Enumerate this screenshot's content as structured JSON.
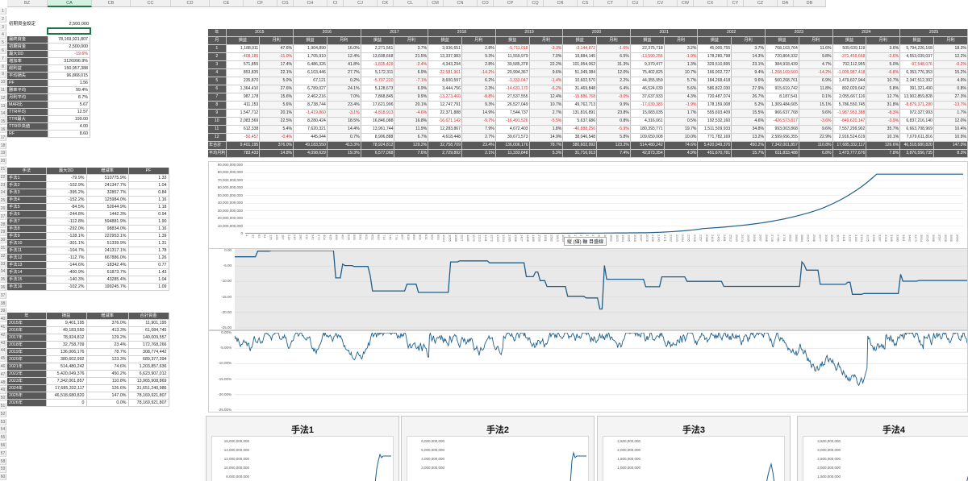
{
  "columns": [
    "BZ",
    "CA",
    "CB",
    "CC",
    "CD",
    "CE",
    "CF",
    "CG",
    "CH",
    "CI",
    "CJ",
    "CK",
    "CL",
    "CM",
    "CN",
    "CO",
    "CP",
    "CQ",
    "CR",
    "CS",
    "CT",
    "CU",
    "CV",
    "CW",
    "CX",
    "CY",
    "CZ",
    "DA",
    "DB"
  ],
  "selected_column": "CA",
  "summary": {
    "label": "初期資金設定",
    "value": "2,500,000",
    "rows": [
      {
        "label": "最終資金",
        "value": "78,169,921,807"
      },
      {
        "label": "初期資金",
        "value": "2,500,000"
      },
      {
        "label": "最大DD",
        "value": "-19.6%",
        "neg": true
      },
      {
        "label": "増加率",
        "value": "3126996.9%"
      },
      {
        "label": "総利益",
        "value": "150,957,388"
      },
      {
        "label": "平均損失",
        "value": "96,868,015"
      },
      {
        "label": "PF",
        "value": "1.56"
      },
      {
        "label": "勝率平均",
        "value": "99.4%"
      },
      {
        "label": "月利平均",
        "value": "8.7%"
      },
      {
        "label": "MAR比",
        "value": "5.67"
      },
      {
        "label": "TTR平均",
        "value": "12.57"
      },
      {
        "label": "TTR最大",
        "value": "199.00"
      },
      {
        "label": "TTR中央値",
        "value": "4.00"
      },
      {
        "label": "RF",
        "value": "8.60"
      }
    ]
  },
  "methods": {
    "headers": [
      "手法",
      "最大DD",
      "増減率",
      "PF"
    ],
    "rows": [
      [
        "手法1",
        "-79.9%",
        "510775.9%",
        "1.33"
      ],
      [
        "手法2",
        "-102.9%",
        "241347.7%",
        "1.04"
      ],
      [
        "手法3",
        "-395.2%",
        "32857.7%",
        "0.84"
      ],
      [
        "手法4",
        "-152.2%",
        "125984.0%",
        "1.16"
      ],
      [
        "手法5",
        "-84.5%",
        "52644.9%",
        "1.18"
      ],
      [
        "手法6",
        "-244.8%",
        "1442.3%",
        "0.94"
      ],
      [
        "手法7",
        "-112.8%",
        "594881.9%",
        "1.90"
      ],
      [
        "手法8",
        "-292.0%",
        "98834.0%",
        "1.16"
      ],
      [
        "手法9",
        "-128.1%",
        "222953.1%",
        "1.39"
      ],
      [
        "手法10",
        "-301.1%",
        "51339.9%",
        "1.31"
      ],
      [
        "手法11",
        "-104.7%",
        "241317.1%",
        "1.78"
      ],
      [
        "手法12",
        "-112.7%",
        "667886.0%",
        "1.26"
      ],
      [
        "手法13",
        "-144.6%",
        "-18342.4%",
        "0.77"
      ],
      [
        "手法14",
        "-400.9%",
        "61873.7%",
        "1.43"
      ],
      [
        "手法15",
        "-140.3%",
        "43285.4%",
        "1.04"
      ],
      [
        "手法16",
        "-102.2%",
        "199245.7%",
        "1.09"
      ]
    ]
  },
  "years": {
    "headers": [
      "年",
      "損益",
      "増減率",
      "合計資金"
    ],
    "rows": [
      [
        "2015年",
        "9,401,195",
        "376.0%",
        "11,901,195"
      ],
      [
        "2016年",
        "49,183,550",
        "413.3%",
        "61,084,745"
      ],
      [
        "2017年",
        "78,924,812",
        "129.2%",
        "140,009,557"
      ],
      [
        "2018年",
        "32,758,709",
        "23.4%",
        "172,768,266"
      ],
      [
        "2019年",
        "136,006,176",
        "78.7%",
        "308,774,442"
      ],
      [
        "2020年",
        "380,602,992",
        "123.3%",
        "689,377,394"
      ],
      [
        "2021年",
        "514,480,242",
        "74.6%",
        "1,203,857,636"
      ],
      [
        "2022年",
        "5,420,049,376",
        "450.2%",
        "6,623,907,012"
      ],
      [
        "2023年",
        "7,342,001,857",
        "110.8%",
        "13,965,908,869"
      ],
      [
        "2024年",
        "17,685,332,117",
        "126.6%",
        "31,651,240,986"
      ],
      [
        "2025年",
        "46,518,680,820",
        "147.0%",
        "78,169,921,807"
      ],
      [
        "2026年",
        "0",
        "0.0%",
        "78,169,921,807"
      ]
    ]
  },
  "monthly": {
    "corner": "年",
    "month_label": "月",
    "years": [
      "2015",
      "2016",
      "2017",
      "2018",
      "2019",
      "2020",
      "2021",
      "2022",
      "2023",
      "2024",
      "2025"
    ],
    "sub": [
      "損益",
      "月利"
    ],
    "rows": [
      [
        "1",
        "1,188,911",
        "47.6%",
        "1,904,890",
        "16.0%",
        "2,271,561",
        "3.7%",
        "3,936,651",
        "2.8%",
        "-5,711,018",
        "-3.3%",
        "-3,144,872",
        "-1.6%",
        "22,375,718",
        "3.2%",
        "45,000,755",
        "3.7%",
        "768,103,764",
        "11.6%",
        "509,639,119",
        "3.6%",
        "5,794,226,168",
        "18.3%"
      ],
      [
        "2",
        "-408,185",
        "-11.0%",
        "1,705,910",
        "12.4%",
        "13,608,668",
        "21.5%",
        "13,337,983",
        "9.3%",
        "11,559,979",
        "7.0%",
        "19,884,145",
        "6.5%",
        "-13,590,255",
        "-1.9%",
        "178,280,798",
        "14.3%",
        "720,864,332",
        "9.8%",
        "-371,459,668",
        "-2.6%",
        "4,553,039,037",
        "12.2%"
      ],
      [
        "3",
        "571,855",
        "17.4%",
        "6,486,326",
        "41.8%",
        "-1,835,429",
        "-2.4%",
        "4,343,294",
        "2.8%",
        "39,585,378",
        "22.2%",
        "101,954,062",
        "31.3%",
        "9,370,477",
        "1.3%",
        "329,510,895",
        "23.1%",
        "384,918,439",
        "4.7%",
        "702,112,955",
        "5.0%",
        "-97,548,076",
        "-0.2%"
      ],
      [
        "4",
        "853,835",
        "22.1%",
        "6,103,446",
        "27.7%",
        "5,172,311",
        "6.9%",
        "-22,581,961",
        "-14.2%",
        "20,994,367",
        "9.6%",
        "51,349,384",
        "12.0%",
        "75,402,825",
        "10.7%",
        "166,002,727",
        "9.4%",
        "-1,208,169,560",
        "-14.2%",
        "-1,009,987,418",
        "-6.8%",
        "6,353,776,353",
        "15.2%"
      ],
      [
        "5",
        "235,870",
        "5.0%",
        "67,121",
        "0.2%",
        "-5,707,220",
        "-7.1%",
        "8,600,597",
        "6.2%",
        "-3,333,047",
        "-1.4%",
        "10,602,570",
        "2.2%",
        "44,355,959",
        "5.7%",
        "184,268,418",
        "9.6%",
        "500,268,761",
        "6.9%",
        "1,479,607,944",
        "10.7%",
        "2,347,512,392",
        "4.9%"
      ],
      [
        "6",
        "1,364,410",
        "27.6%",
        "6,789,027",
        "24.1%",
        "5,128,673",
        "6.9%",
        "3,444,756",
        "2.3%",
        "-14,631,170",
        "-6.2%",
        "31,469,848",
        "6.4%",
        "46,524,039",
        "5.6%",
        "586,822,030",
        "27.9%",
        "915,619,742",
        "11.8%",
        "892,029,642",
        "5.8%",
        "391,321,490",
        "0.8%"
      ],
      [
        "7",
        "987,178",
        "15.6%",
        "2,462,216",
        "7.0%",
        "7,868,845",
        "9.9%",
        "-13,273,460",
        "-8.8%",
        "27,537,555",
        "12.4%",
        "-15,886,768",
        "-3.0%",
        "37,637,933",
        "4.3%",
        "720,487,074",
        "26.7%",
        "8,187,541",
        "0.1%",
        "2,055,667,116",
        "12.7%",
        "13,902,859,828",
        "27.3%"
      ],
      [
        "8",
        "411,153",
        "5.6%",
        "8,738,744",
        "23.4%",
        "17,621,996",
        "20.1%",
        "12,747,791",
        "9.3%",
        "26,527,049",
        "10.7%",
        "49,762,713",
        "9.9%",
        "-17,039,383",
        "-1.9%",
        "178,159,008",
        "5.2%",
        "1,309,484,665",
        "15.1%",
        "5,786,550,745",
        "31.8%",
        "-8,879,371,280",
        "-13.7%"
      ],
      [
        "9",
        "1,547,712",
        "20.1%",
        "-1,419,860",
        "-3.1%",
        "-4,818,913",
        "-4.6%",
        "22,371,888",
        "14.9%",
        "7,544,737",
        "2.7%",
        "131,816,891",
        "23.8%",
        "15,083,035",
        "1.7%",
        "555,693,409",
        "15.5%",
        "966,637,768",
        "9.6%",
        "-1,987,953,388",
        "-8.3%",
        "972,327,993",
        "1.7%"
      ],
      [
        "10",
        "2,083,569",
        "22.5%",
        "8,280,424",
        "18.5%",
        "16,846,088",
        "16.8%",
        "-16,671,142",
        "-9.7%",
        "-16,491,526",
        "-5.5%",
        "5,637,686",
        "0.8%",
        "4,316,061",
        "0.5%",
        "192,532,160",
        "4.6%",
        "-426,573,817",
        "-3.6%",
        "-849,620,147",
        "-3.9%",
        "6,837,216,140",
        "12.0%"
      ],
      [
        "11",
        "612,338",
        "5.4%",
        "7,620,321",
        "14.4%",
        "13,961,744",
        "11.9%",
        "12,283,867",
        "7.9%",
        "4,672,403",
        "1.8%",
        "-40,888,256",
        "-5.9%",
        "180,393,771",
        "19.7%",
        "1,511,509,933",
        "34.8%",
        "993,003,868",
        "9.6%",
        "7,557,299,902",
        "35.7%",
        "6,663,708,969",
        "10.4%"
      ],
      [
        "12",
        "-50,457",
        "-0.4%",
        "445,044",
        "0.7%",
        "8,906,888",
        "6.7%",
        "4,618,448",
        "2.7%",
        "39,671,573",
        "14.9%",
        "38,046,548",
        "5.8%",
        "109,650,008",
        "10.0%",
        "771,782,169",
        "13.2%",
        "2,599,656,355",
        "22.9%",
        "2,916,524,619",
        "10.1%",
        "7,679,611,816",
        "10.9%"
      ]
    ],
    "total_label": "年合計",
    "total": [
      "9,401,195",
      "376.0%",
      "49,183,550",
      "413.3%",
      "78,924,812",
      "129.2%",
      "32,758,709",
      "23.4%",
      "136,006,176",
      "78.7%",
      "380,602,992",
      "123.3%",
      "514,480,242",
      "74.6%",
      "5,420,049,376",
      "450.2%",
      "7,342,001,857",
      "110.8%",
      "17,685,332,117",
      "126.6%",
      "46,518,680,820",
      "147.0%"
    ],
    "avg_label": "平均月利",
    "avg": [
      "783,433",
      "14.8%",
      "4,098,629",
      "19.3%",
      "6,577,068",
      "7.6%",
      "2,729,892",
      "2.1%",
      "11,333,848",
      "5.3%",
      "31,716,913",
      "7.4%",
      "42,873,354",
      "4.9%",
      "451,670,781",
      "15.7%",
      "611,833,488",
      "6.8%",
      "1,473,777,676",
      "7.8%",
      "3,876,556,735",
      "8.3%"
    ]
  },
  "equity_chart": {
    "type": "line",
    "y_ticks": [
      "90,000,000,000",
      "80,000,000,000",
      "70,000,000,000",
      "60,000,000,000",
      "50,000,000,000",
      "40,000,000,000",
      "30,000,000,000",
      "20,000,000,000",
      "10,000,000,000",
      "0"
    ],
    "axis_title": "縦 (値) 軸 目盛線",
    "color": "#1f5f8b"
  },
  "dd_chart": {
    "y_ticks": [
      "0.00",
      "-5.00",
      "-10.00",
      "-15.00",
      "-20.00",
      "-25.00"
    ],
    "color": "#1f5f8b"
  },
  "dd_chart2": {
    "y_ticks": [
      "0.00%",
      "-5.00%",
      "-10.00%",
      "-15.00%",
      "-20.00%",
      "-25.00%"
    ],
    "color": "#1f5f8b"
  },
  "method_panes": [
    {
      "title": "手法1",
      "ticks": [
        "16,000,000,000",
        "14,000,000,000",
        "12,000,000,000",
        "10,000,000,000",
        "8,000,000,000",
        "6,000,000,000"
      ]
    },
    {
      "title": "手法2",
      "ticks": [
        "6,000,000,000",
        "5,000,000,000",
        "4,000,000,000",
        "3,000,000,000"
      ]
    },
    {
      "title": "手法3",
      "ticks": [
        "2,500,000,000",
        "2,000,000,000",
        "1,500,000,000",
        "1,000,000,000"
      ]
    },
    {
      "title": "手法4",
      "ticks": [
        "3,500,000,000",
        "3,000,000,000",
        "2,500,000,000",
        "2,000,000,000",
        "1,500,000,000"
      ]
    }
  ],
  "row_numbers": [
    "1",
    "2",
    "3",
    "4",
    "5",
    "6",
    "7",
    "8",
    "9",
    "10",
    "11",
    "12",
    "13",
    "14",
    "15",
    "16",
    "17",
    "18",
    "19",
    "20",
    "21",
    "22",
    "23",
    "24",
    "25",
    "26",
    "27",
    "28",
    "29",
    "30",
    "31",
    "32",
    "33",
    "34",
    "35",
    "36",
    "37",
    "38",
    "39",
    "40",
    "41",
    "42",
    "43",
    "44",
    "45",
    "46",
    "47",
    "48",
    "49",
    "50",
    "51",
    "52",
    "53",
    "54",
    "55",
    "56",
    "57",
    "58",
    "59",
    "60"
  ]
}
